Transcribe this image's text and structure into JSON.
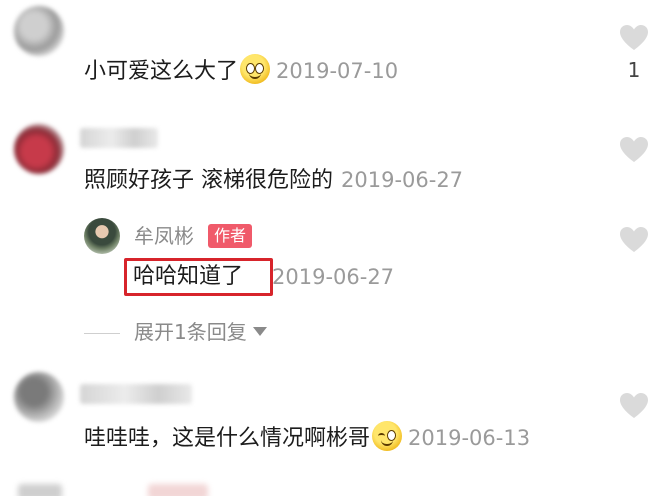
{
  "comments": [
    {
      "text": "小可爱这么大了",
      "emoji": "smiling-emoji",
      "date": "2019-07-10",
      "likes": "1"
    },
    {
      "text": "照顾好孩子 滚梯很危险的",
      "date": "2019-06-27",
      "reply": {
        "author": "牟凤彬",
        "badge": "作者",
        "text": "哈哈知道了",
        "date": "2019-06-27"
      },
      "expand_label": "展开1条回复"
    },
    {
      "text": "哇哇哇，这是什么情况啊彬哥",
      "emoji": "smirking-emoji",
      "date": "2019-06-13"
    }
  ],
  "colors": {
    "author_badge": "#f05a6a",
    "highlight_border": "#d7242b",
    "date_gray": "#9a9a9a"
  },
  "icons": {
    "like": "heart-outline-icon",
    "expand": "caret-down-icon"
  }
}
